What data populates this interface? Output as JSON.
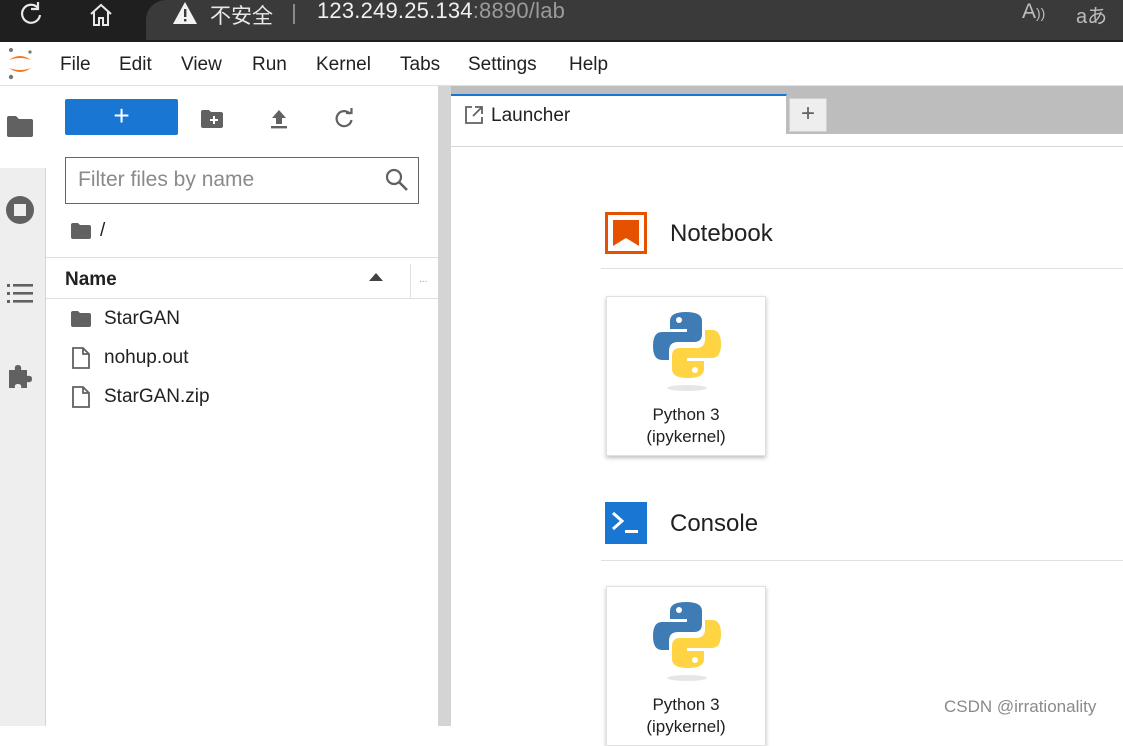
{
  "browser": {
    "insecure_label": "不安全",
    "url_host": "123.249.25.134",
    "url_rest": ":8890/lab",
    "read_aloud": "A)",
    "translate": "aあ"
  },
  "menubar": {
    "items": [
      "File",
      "Edit",
      "View",
      "Run",
      "Kernel",
      "Tabs",
      "Settings",
      "Help"
    ]
  },
  "filebrowser": {
    "new_button": "+",
    "filter_placeholder": "Filter files by name",
    "breadcrumb": "/",
    "column_name": "Name",
    "column_more": "...",
    "files": [
      {
        "name": "StarGAN",
        "type": "folder"
      },
      {
        "name": "nohup.out",
        "type": "file"
      },
      {
        "name": "StarGAN.zip",
        "type": "file"
      }
    ]
  },
  "main": {
    "tab_label": "Launcher",
    "add_tab": "+",
    "sections": [
      {
        "title": "Notebook",
        "icon": "notebook-icon",
        "card_line1": "Python 3",
        "card_line2": "(ipykernel)"
      },
      {
        "title": "Console",
        "icon": "console-icon",
        "card_line1": "Python 3",
        "card_line2": "(ipykernel)"
      }
    ]
  },
  "colors": {
    "accent": "#1976d2",
    "notebook_orange": "#e65100",
    "browser_bar": "#1f1f1f"
  },
  "watermark": "CSDN @irrationality"
}
